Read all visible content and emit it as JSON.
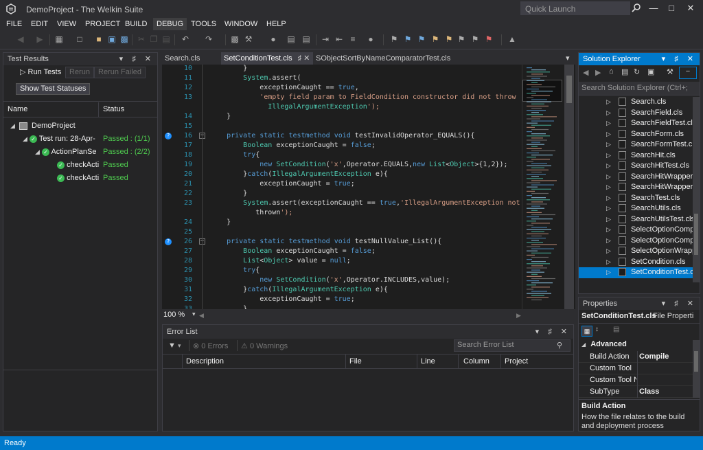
{
  "window": {
    "title": "DemoProject - The Welkin Suite",
    "quick_launch_placeholder": "Quick Launch"
  },
  "menu": [
    "FILE",
    "EDIT",
    "VIEW",
    "PROJECT",
    "BUILD",
    "DEBUG",
    "TOOLS",
    "WINDOW",
    "HELP"
  ],
  "test_results": {
    "title": "Test Results",
    "run_tests": "Run Tests",
    "rerun": "Rerun",
    "rerun_failed": "Rerun Failed",
    "show_statuses": "Show Test Statuses",
    "col_name": "Name",
    "col_status": "Status",
    "tree": [
      {
        "label": "DemoProject",
        "status": ""
      },
      {
        "label": "Test run: 28-Apr-",
        "status": "Passed : (1/1)"
      },
      {
        "label": "ActionPlanSe",
        "status": "Passed : (2/2)"
      },
      {
        "label": "checkActi",
        "status": "Passed"
      },
      {
        "label": "checkActi",
        "status": "Passed"
      }
    ]
  },
  "editor": {
    "tabs": [
      "Search.cls",
      "SetConditionTest.cls",
      "SObjectSortByNameComparatorTest.cls"
    ],
    "zoom": "100 %",
    "lines": [
      {
        "n": "10",
        "code": "        }"
      },
      {
        "n": "11",
        "code": "        System.assert("
      },
      {
        "n": "12",
        "code": "            exceptionCaught == true,"
      },
      {
        "n": "13",
        "code": "            'empty field param to FieldCondition constructor did not throw"
      },
      {
        "n": "",
        "code": "              IllegalArgumentException');"
      },
      {
        "n": "14",
        "code": "    }"
      },
      {
        "n": "15",
        "code": ""
      },
      {
        "n": "16",
        "code": "    private static testmethod void testInvalidOperator_EQUALS(){"
      },
      {
        "n": "17",
        "code": "        Boolean exceptionCaught = false;"
      },
      {
        "n": "18",
        "code": "        try{"
      },
      {
        "n": "19",
        "code": "            new SetCondition('x',Operator.EQUALS,new List<Object>{1,2});"
      },
      {
        "n": "20",
        "code": "        }catch(IllegalArgumentException e){"
      },
      {
        "n": "21",
        "code": "            exceptionCaught = true;"
      },
      {
        "n": "22",
        "code": "        }"
      },
      {
        "n": "23",
        "code": "        System.assert(exceptionCaught == true,'IllegalArgumentException not"
      },
      {
        "n": "",
        "code": "           thrown');"
      },
      {
        "n": "24",
        "code": "    }"
      },
      {
        "n": "25",
        "code": ""
      },
      {
        "n": "26",
        "code": "    private static testmethod void testNullValue_List(){"
      },
      {
        "n": "27",
        "code": "        Boolean exceptionCaught = false;"
      },
      {
        "n": "28",
        "code": "        List<Object> value = null;"
      },
      {
        "n": "29",
        "code": "        try{"
      },
      {
        "n": "30",
        "code": "            new SetCondition('x',Operator.INCLUDES,value);"
      },
      {
        "n": "31",
        "code": "        }catch(IllegalArgumentException e){"
      },
      {
        "n": "32",
        "code": "            exceptionCaught = true;"
      },
      {
        "n": "33",
        "code": "        }"
      }
    ]
  },
  "error_list": {
    "title": "Error List",
    "errors": "0 Errors",
    "warnings": "0 Warnings",
    "search_placeholder": "Search Error List",
    "columns": [
      "Description",
      "File",
      "Line",
      "Column",
      "Project"
    ]
  },
  "solution_explorer": {
    "title": "Solution Explorer",
    "search_placeholder": "Search Solution Explorer (Ctrl+;",
    "items": [
      "Search.cls",
      "SearchField.cls",
      "SearchFieldTest.cls",
      "SearchForm.cls",
      "SearchFormTest.cls",
      "SearchHit.cls",
      "SearchHitTest.cls",
      "SearchHitWrapper.",
      "SearchHitWrapperT",
      "SearchTest.cls",
      "SearchUtils.cls",
      "SearchUtilsTest.cls",
      "SelectOptionComp",
      "SelectOptionComp",
      "SelectOptionWrapp",
      "SetCondition.cls",
      "SetConditionTest.cls"
    ],
    "selected_index": 16
  },
  "properties": {
    "title": "Properties",
    "object": "SetConditionTest.cls",
    "object_type": "File Properti",
    "category": "Advanced",
    "rows": [
      {
        "name": "Build Action",
        "value": "Compile"
      },
      {
        "name": "Custom Tool",
        "value": ""
      },
      {
        "name": "Custom Tool N",
        "value": ""
      },
      {
        "name": "SubType",
        "value": "Class"
      }
    ],
    "desc_title": "Build Action",
    "desc_text": "How the file relates to the build and deployment process"
  },
  "status": "Ready",
  "colors": {
    "accent": "#007acc",
    "passed": "#4ec94e",
    "line_numbers": "#2b91af"
  }
}
